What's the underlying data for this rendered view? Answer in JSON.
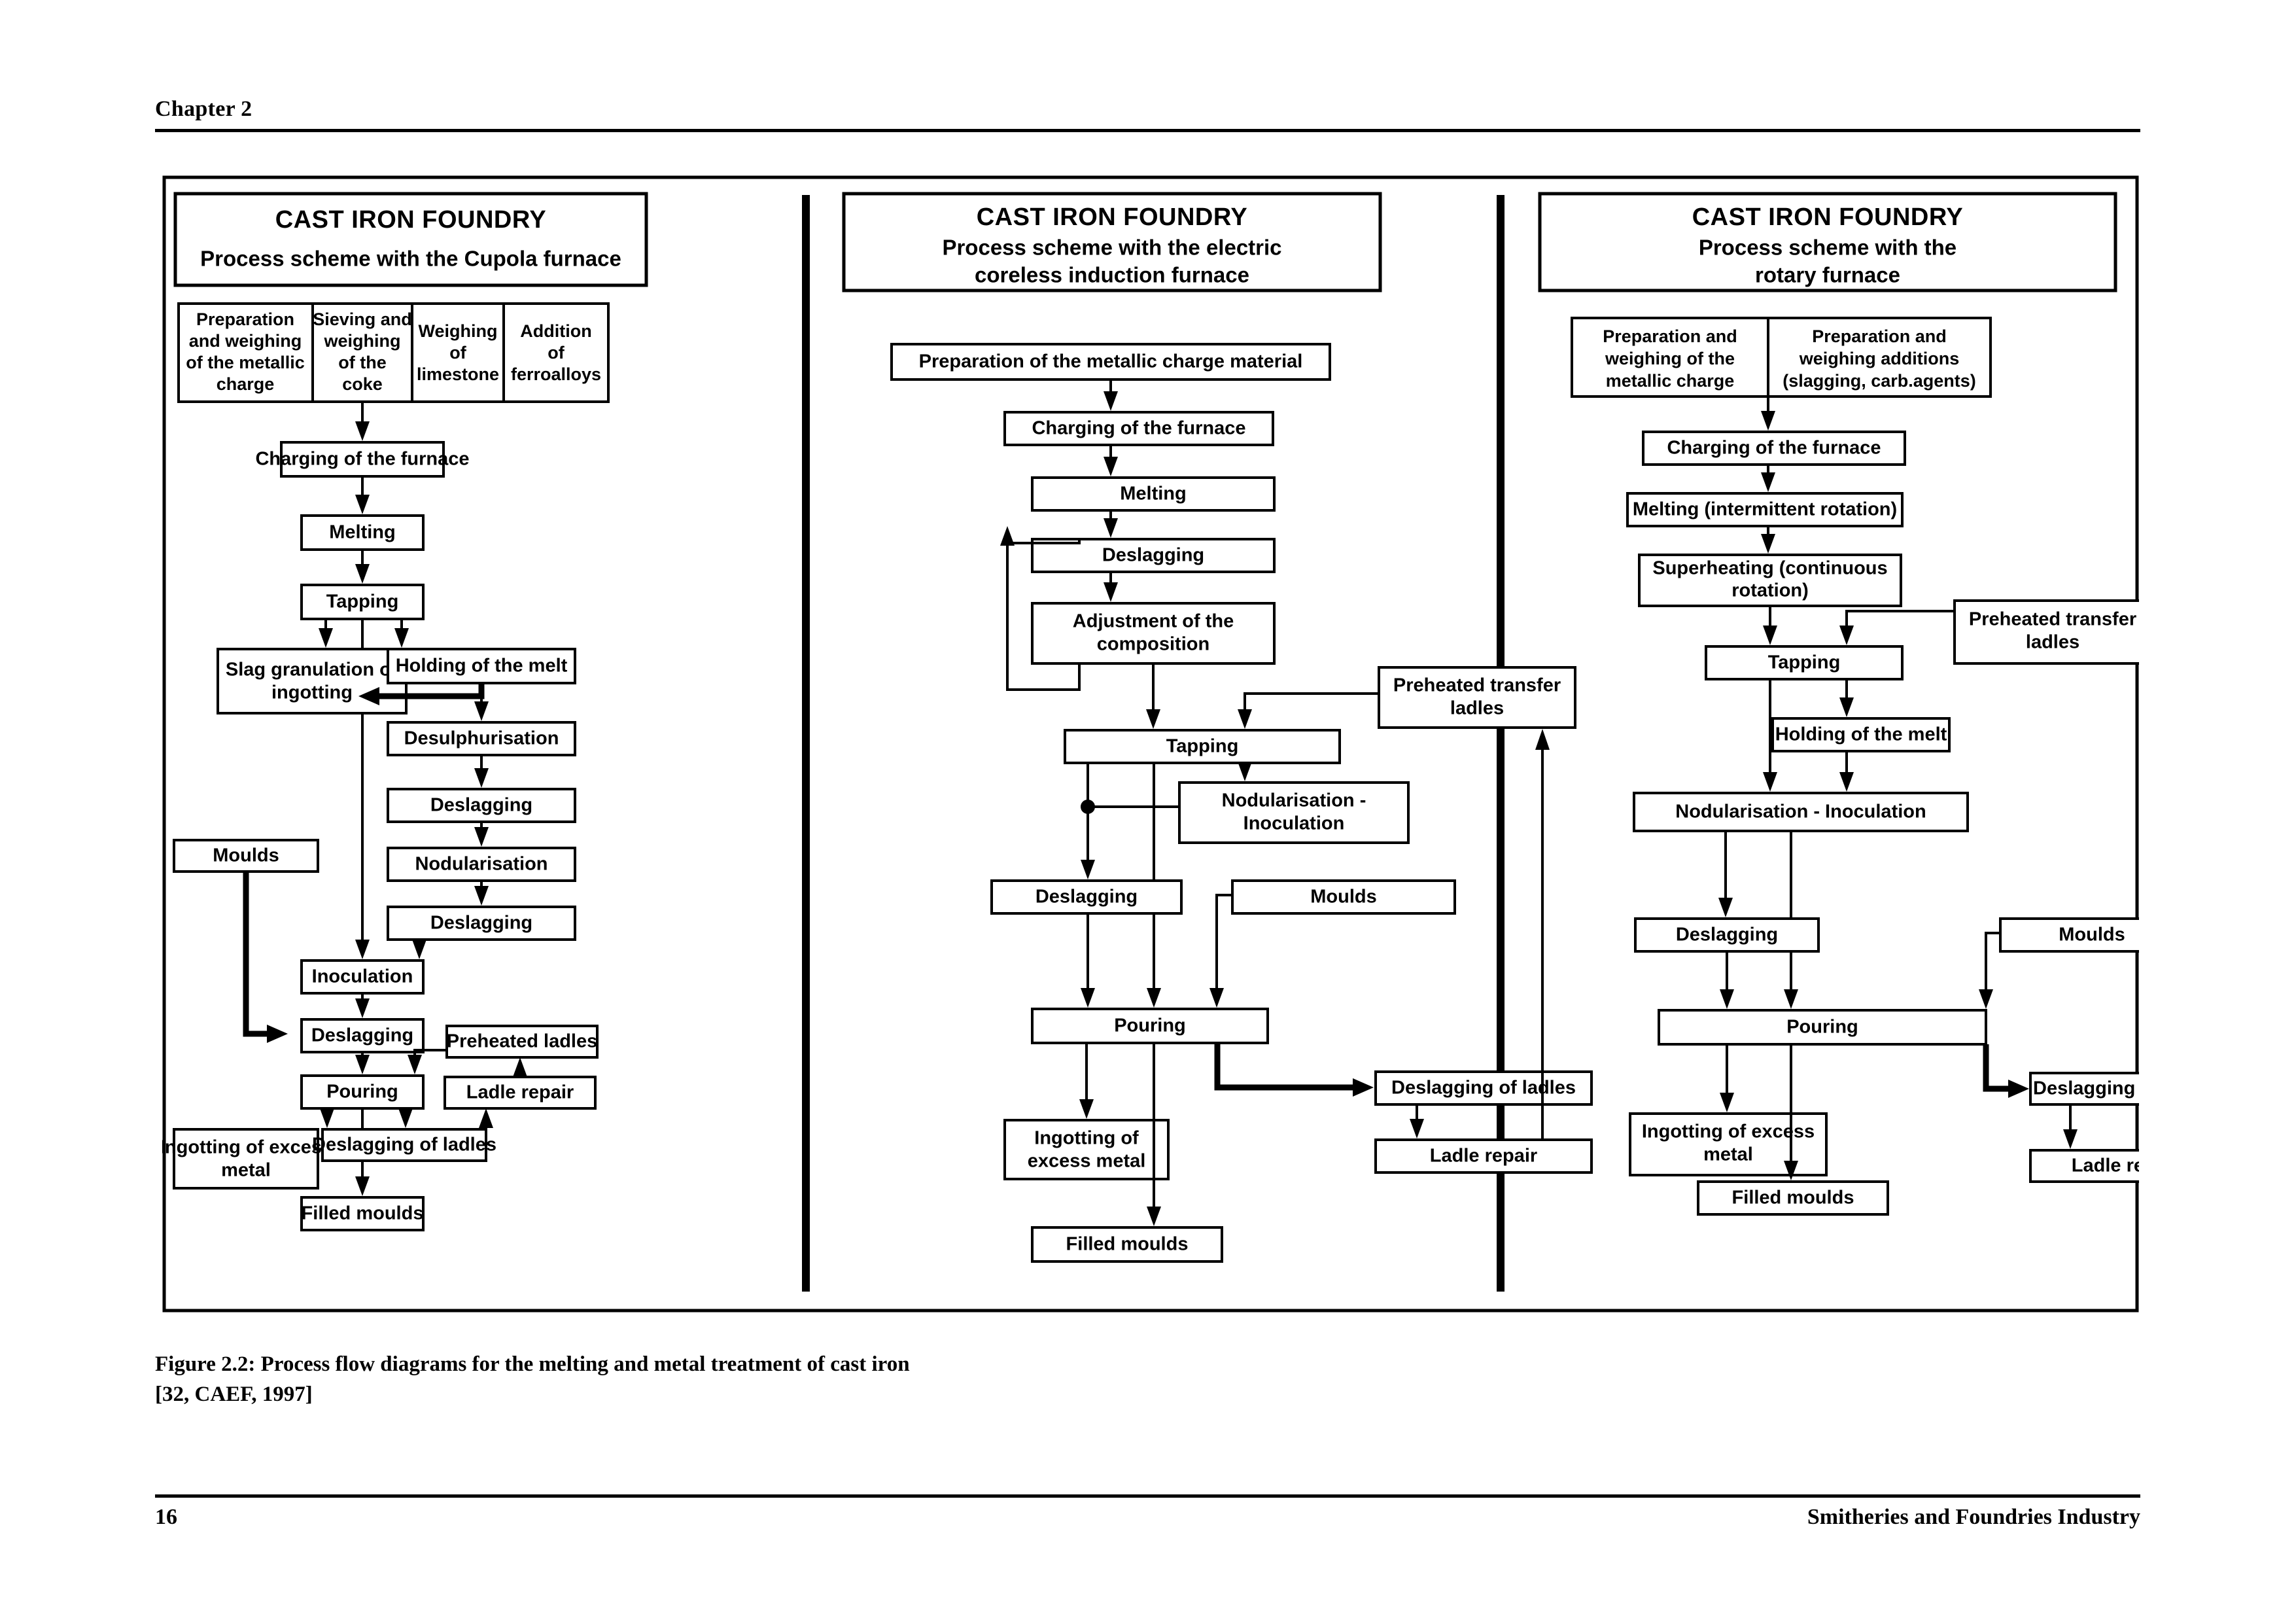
{
  "page": {
    "running_head": "Chapter 2",
    "folio": "16",
    "footer_right": "Smitheries and Foundries Industry",
    "caption": "Figure 2.2: Process flow diagrams for the melting and metal treatment of cast iron\n[32, CAEF, 1997]"
  },
  "diagram": {
    "type": "flowchart",
    "panels": [
      {
        "id": "cupola",
        "title": "CAST IRON FOUNDRY",
        "subtitle": "Process scheme with the Cupola furnace",
        "input_row": [
          "Preparation and weighing of the metallic charge",
          "Sieving and weighing of the coke",
          "Weighing of limestone",
          "Addition of ferroalloys"
        ],
        "nodes": {
          "charging": "Charging of the furnace",
          "melting": "Melting",
          "tapping": "Tapping",
          "slag": "Slag granulation or ingotting",
          "holding": "Holding of the melt",
          "desulph": "Desulphurisation",
          "deslag1": "Deslagging",
          "nodularisation": "Nodularisation",
          "deslag2": "Deslagging",
          "moulds": "Moulds",
          "inoculation": "Inoculation",
          "deslag3": "Deslagging",
          "preheated_ladles": "Preheated ladles",
          "pouring": "Pouring",
          "ladle_repair": "Ladle repair",
          "ingotting": "Ingotting of excess metal",
          "deslag_ladles": "Deslagging of ladles",
          "filled_moulds": "Filled moulds"
        }
      },
      {
        "id": "induction",
        "title": "CAST IRON FOUNDRY",
        "subtitle": "Process scheme with the electric coreless induction furnace",
        "nodes": {
          "preparation": "Preparation of the  metallic charge material",
          "charging": "Charging of the furnace",
          "melting": "Melting",
          "deslagging": "Deslagging",
          "adjustment": "Adjustment of the composition",
          "preheated_transfer": "Preheated transfer ladles",
          "tapping": "Tapping",
          "nodularisation": "Nodularisation - Inoculation",
          "deslag2": "Deslagging",
          "moulds": "Moulds",
          "pouring": "Pouring",
          "deslag_ladles": "Deslagging of ladles",
          "ingotting": "Ingotting of excess metal",
          "ladle_repair": "Ladle repair",
          "filled_moulds": "Filled moulds"
        }
      },
      {
        "id": "rotary",
        "title": "CAST IRON FOUNDRY",
        "subtitle": "Process scheme with the rotary furnace",
        "input_row": [
          "Preparation and weighing of the metallic charge",
          "Preparation and weighing additions (slagging, carb.agents)"
        ],
        "nodes": {
          "charging": "Charging of the furnace",
          "melting": "Melting (intermittent rotation)",
          "superheating": "Superheating (continuous rotation)",
          "tapping": "Tapping",
          "preheated_transfer": "Preheated transfer ladles",
          "holding": "Holding of the melt",
          "nodularisation": "Nodularisation - Inoculation",
          "deslagging": "Deslagging",
          "moulds": "Moulds",
          "pouring": "Pouring",
          "deslag_ladles": "Deslagging of ladles",
          "ingotting": "Ingotting of excess metal",
          "ladle_repair": "Ladle repair",
          "filled_moulds": "Filled moulds"
        }
      }
    ]
  },
  "colors": {
    "ink": "#000000",
    "paper": "#ffffff"
  }
}
